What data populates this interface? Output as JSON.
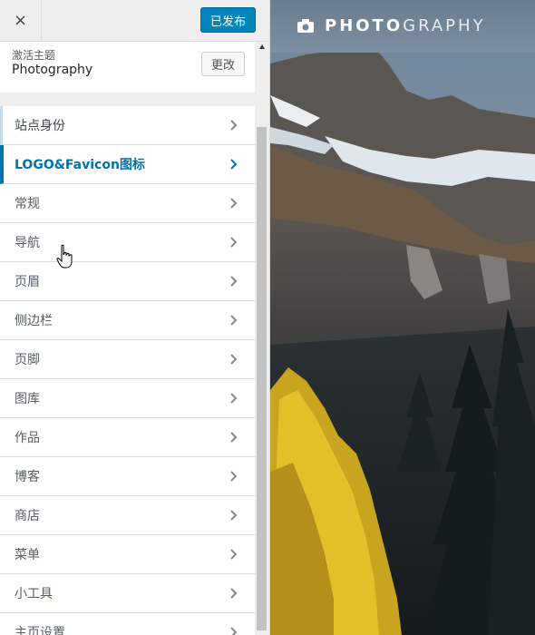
{
  "topbar": {
    "close_icon": "×",
    "publish_label": "已发布"
  },
  "theme": {
    "active_label": "激活主题",
    "name": "Photography",
    "change_label": "更改"
  },
  "menu": {
    "items": [
      {
        "label": "站点身份"
      },
      {
        "label": "LOGO&Favicon图标"
      },
      {
        "label": "常规"
      },
      {
        "label": "导航"
      },
      {
        "label": "页眉"
      },
      {
        "label": "侧边栏"
      },
      {
        "label": "页脚"
      },
      {
        "label": "图库"
      },
      {
        "label": "作品"
      },
      {
        "label": "博客"
      },
      {
        "label": "商店"
      },
      {
        "label": "菜单"
      },
      {
        "label": "小工具"
      },
      {
        "label": "主页设置"
      }
    ]
  },
  "preview": {
    "logo_bold": "PHOTO",
    "logo_light": "GRAPHY"
  },
  "colors": {
    "accent": "#0073aa",
    "publish_bg": "#0085ba"
  }
}
